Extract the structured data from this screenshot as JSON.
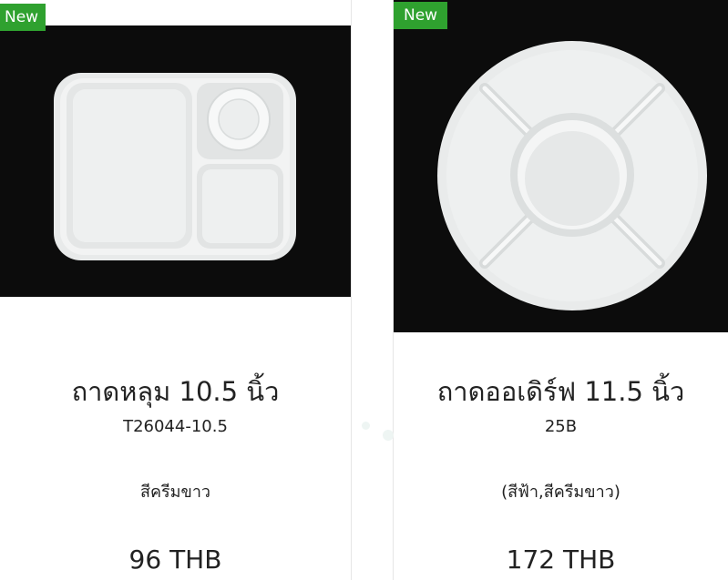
{
  "products": [
    {
      "badge": "New",
      "name": "ถาดหลุม 10.5 นิ้ว",
      "sku": "T26044-10.5",
      "option": "สีครีมขาว",
      "price": "96 THB"
    },
    {
      "badge": "New",
      "name": "ถาดออเดิร์ฟ 11.5 นิ้ว",
      "sku": "25B",
      "option": "(สีฟ้า,สีครีมขาว)",
      "price": "172 THB"
    }
  ],
  "colors": {
    "badge": "#2fa12f",
    "photo_background": "#0c0c0c",
    "product_white": "#eceeed"
  }
}
